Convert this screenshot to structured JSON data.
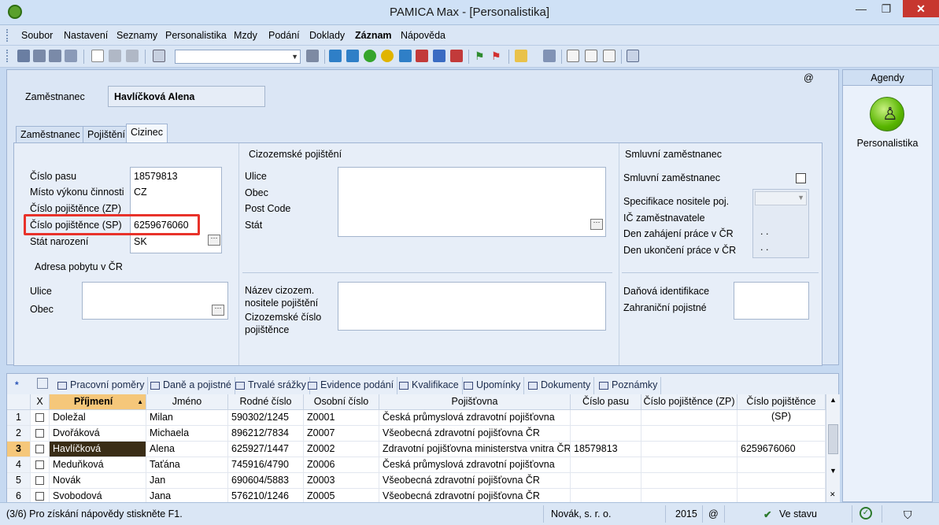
{
  "window": {
    "title": "PAMICA Max - [Personalistika]",
    "min": "—",
    "max": "❐",
    "close": "✕"
  },
  "menu": [
    "Soubor",
    "Nastavení",
    "Seznamy",
    "Personalistika",
    "Mzdy",
    "Podání",
    "Doklady",
    "Záznam",
    "Nápověda"
  ],
  "header": {
    "employee_label": "Zaměstnanec",
    "employee_value": "Havlíčková Alena",
    "at_sign": "@"
  },
  "tabs": [
    "Zaměstnanec",
    "Pojištění",
    "Cizinec"
  ],
  "active_tab": "Cizinec",
  "foreigner": {
    "passport_label": "Číslo pasu",
    "passport_value": "18579813",
    "workplace_label": "Místo výkonu činnosti",
    "workplace_value": "CZ",
    "insured_zp_label": "Číslo pojištěnce (ZP)",
    "insured_zp_value": "",
    "insured_sp_label": "Číslo pojištěnce (SP)",
    "insured_sp_value": "6259676060",
    "birth_state_label": "Stát narození",
    "birth_state_value": "SK",
    "address_title": "Adresa pobytu v ČR",
    "street_label": "Ulice",
    "city_label": "Obec"
  },
  "foreign_insurance": {
    "title": "Cizozemské pojištění",
    "street_label": "Ulice",
    "city_label": "Obec",
    "post_code_label": "Post Code",
    "state_label": "Stát",
    "insurer_name_label_1": "Název cizozem.",
    "insurer_name_label_2": "nositele pojištění",
    "foreign_number_label_1": "Cizozemské číslo",
    "foreign_number_label_2": "pojištěnce"
  },
  "contract": {
    "title": "Smluvní zaměstnanec",
    "contract_employee_label": "Smluvní zaměstnanec",
    "insurer_spec_label": "Specifikace nositele poj.",
    "employer_id_label": "IČ zaměstnavatele",
    "start_label": "Den zahájení práce v ČR",
    "start_value": ". .",
    "end_label": "Den ukončení práce v ČR",
    "end_value": ". .",
    "tax_id_label": "Daňová identifikace",
    "foreign_insurance_label": "Zahraniční pojistné"
  },
  "bottom_tabs": [
    "Pracovní poměry",
    "Daně a pojistné",
    "Trvalé srážky",
    "Evidence podání",
    "Kvalifikace",
    "Upomínky",
    "Dokumenty",
    "Poznámky"
  ],
  "grid": {
    "headers": [
      "X",
      "Příjmení",
      "Jméno",
      "Rodné číslo",
      "Osobní číslo",
      "Pojišťovna",
      "Číslo pasu",
      "Číslo pojištěnce (ZP)",
      "Číslo pojištěnce (SP)"
    ],
    "rows": [
      [
        "1",
        "Doležal",
        "Milan",
        "590302/1245",
        "Z0001",
        "Česká průmyslová zdravotní pojišťovna",
        "",
        "",
        ""
      ],
      [
        "2",
        "Dvořáková",
        "Michaela",
        "896212/7834",
        "Z0007",
        "Všeobecná zdravotní pojišťovna ČR",
        "",
        "",
        ""
      ],
      [
        "3",
        "Havlíčková",
        "Alena",
        "625927/1447",
        "Z0002",
        "Zdravotní pojišťovna ministerstva vnitra ČR",
        "18579813",
        "",
        "6259676060"
      ],
      [
        "4",
        "Meduňková",
        "Taťána",
        "745916/4790",
        "Z0006",
        "Česká průmyslová zdravotní pojišťovna",
        "",
        "",
        ""
      ],
      [
        "5",
        "Novák",
        "Jan",
        "690604/5883",
        "Z0003",
        "Všeobecná zdravotní pojišťovna ČR",
        "",
        "",
        ""
      ],
      [
        "6",
        "Svobodová",
        "Jana",
        "576210/1246",
        "Z0005",
        "Všeobecná zdravotní pojišťovna ČR",
        "",
        "",
        ""
      ]
    ]
  },
  "agenda": {
    "title": "Agendy",
    "item": "Personalistika"
  },
  "status": {
    "help": "(3/6) Pro získání nápovědy stiskněte F1.",
    "company": "Novák, s. r. o.",
    "year": "2015",
    "at": "@",
    "state": "Ve stavu"
  },
  "colors": {
    "highlight_box": "#e8322a",
    "selected_row": "#3a2d16",
    "sorted_header": "#f5c77a"
  }
}
